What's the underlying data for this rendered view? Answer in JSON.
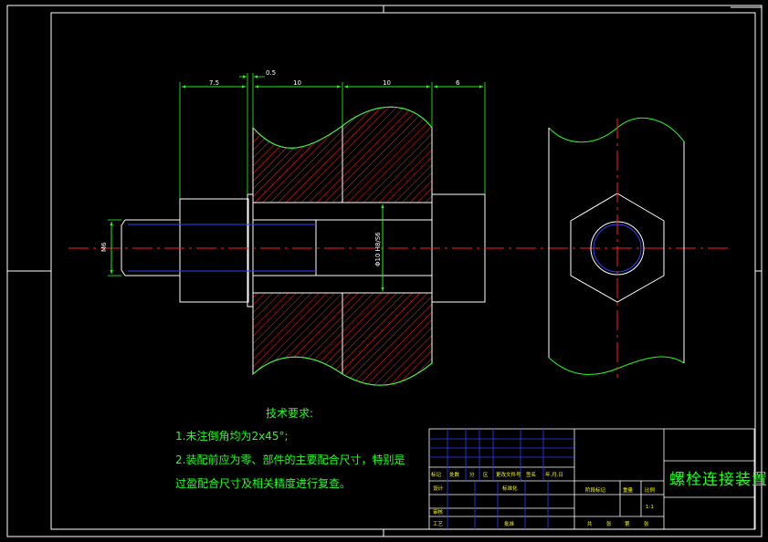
{
  "drawing": {
    "title": "螺栓连接装置",
    "dimensions": {
      "d1": "7.5",
      "d2": "0.5",
      "d3": "10",
      "d4": "10",
      "d5": "6",
      "thread": "M6",
      "fit": "Φ10 H8/S6"
    },
    "notes": {
      "title": "技术要求:",
      "line1": "1.未注倒角均为2x45°;",
      "line2": "2.装配前应为零、部件的主要配合尺寸，特别是",
      "line3": "过盈配合尺寸及相关精度进行复查。"
    },
    "title_block": {
      "r1": [
        "标记",
        "处数",
        "分",
        "区",
        "更改文件号",
        "签名",
        "年.月.日"
      ],
      "design": "设计",
      "standardize": "标准化",
      "stage": "阶段标记",
      "weight": "重量",
      "scale": "比例",
      "scale_value": "1:1",
      "review": "审核",
      "process": "工艺",
      "approve": "批准",
      "sheet1": "共",
      "sheet2": "张",
      "sheet3": "第",
      "sheet4": "张"
    }
  },
  "colors": {
    "frame": "#ffffff",
    "dimension": "#22ff22",
    "hatch": "#ff2020",
    "centerline": "#ff2020",
    "thread": "#2f3fff",
    "text_yellow": "#ffff00"
  }
}
